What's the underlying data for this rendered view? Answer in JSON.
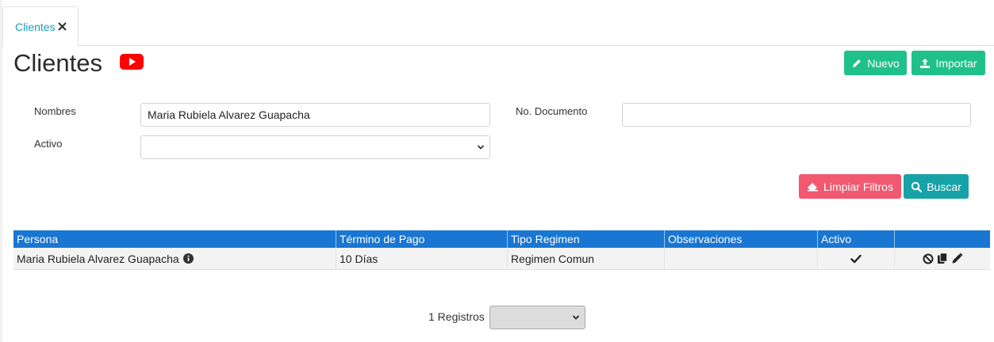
{
  "tab": {
    "label": "Clientes"
  },
  "page": {
    "title": "Clientes"
  },
  "toolbar": {
    "nuevo_label": "Nuevo",
    "importar_label": "Importar"
  },
  "filters": {
    "nombres_label": "Nombres",
    "nombres_value": "Maria Rubiela Alvarez Guapacha",
    "documento_label": "No. Documento",
    "documento_value": "",
    "activo_label": "Activo",
    "activo_value": "",
    "limpiar_label": "Limpiar Filtros",
    "buscar_label": "Buscar"
  },
  "table": {
    "headers": [
      "Persona",
      "Término de Pago",
      "Tipo Regimen",
      "Observaciones",
      "Activo",
      ""
    ],
    "rows": [
      {
        "persona": "Maria Rubiela Alvarez Guapacha",
        "termino": "10 Días",
        "regimen": "Regimen Comun",
        "observaciones": "",
        "activo": true
      }
    ]
  },
  "footer": {
    "count_label": "1 Registros",
    "page_size_value": ""
  },
  "colors": {
    "accent": "#17a2b8",
    "success": "#20c08a",
    "danger": "#f0596f",
    "header": "#1976d2",
    "youtube": "#ff0000"
  },
  "icons": [
    "close-icon",
    "youtube-icon",
    "pencil-icon",
    "upload-icon",
    "eraser-icon",
    "search-icon",
    "info-icon",
    "check-icon",
    "ban-icon",
    "copy-icon",
    "chevron-down-icon"
  ]
}
